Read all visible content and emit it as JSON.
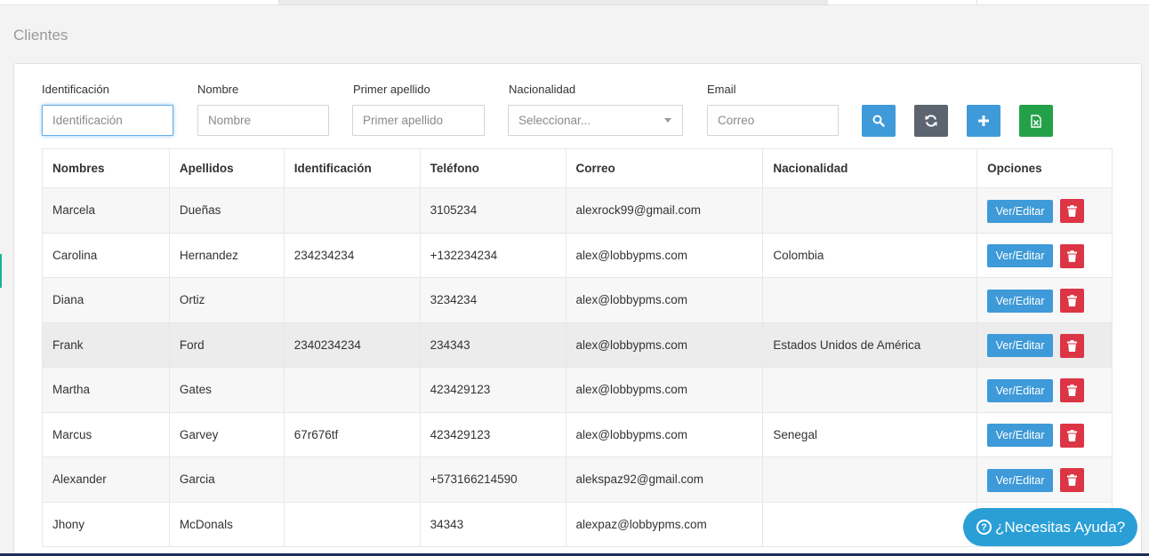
{
  "page": {
    "title": "Clientes"
  },
  "filters": {
    "identificacion": {
      "label": "Identificación",
      "placeholder": "Identificación"
    },
    "nombre": {
      "label": "Nombre",
      "placeholder": "Nombre"
    },
    "primer_apellido": {
      "label": "Primer apellido",
      "placeholder": "Primer apellido"
    },
    "nacionalidad": {
      "label": "Nacionalidad",
      "selected": "Seleccionar..."
    },
    "email": {
      "label": "Email",
      "placeholder": "Correo"
    }
  },
  "toolbar": {
    "search_icon": "search-icon",
    "refresh_icon": "refresh-icon",
    "add_icon": "plus-icon",
    "excel_icon": "excel-icon"
  },
  "table": {
    "headers": [
      "Nombres",
      "Apellidos",
      "Identificación",
      "Teléfono",
      "Correo",
      "Nacionalidad",
      "Opciones"
    ],
    "rows": [
      [
        "Marcela",
        "Dueñas",
        "",
        "3105234",
        "alexrock99@gmail.com",
        ""
      ],
      [
        "Carolina",
        "Hernandez",
        "234234234",
        "+132234234",
        "alex@lobbypms.com",
        "Colombia"
      ],
      [
        "Diana",
        "Ortiz",
        "",
        "3234234",
        "alex@lobbypms.com",
        ""
      ],
      [
        "Frank",
        "Ford",
        "2340234234",
        "234343",
        "alex@lobbypms.com",
        "Estados Unidos de América"
      ],
      [
        "Martha",
        "Gates",
        "",
        "423429123",
        "alex@lobbypms.com",
        ""
      ],
      [
        "Marcus",
        "Garvey",
        "67r676tf",
        "423429123",
        "alex@lobbypms.com",
        "Senegal"
      ],
      [
        "Alexander",
        "Garcia",
        "",
        "+573166214590",
        "alekspaz92@gmail.com",
        ""
      ],
      [
        "Jhony",
        "McDonals",
        "",
        "34343",
        "alexpaz@lobbypms.com",
        ""
      ]
    ],
    "edit_label": "Ver/Editar"
  },
  "help": {
    "label": "¿Necesitas Ayuda?"
  },
  "colors": {
    "primary": "#3e9ad8",
    "danger": "#dc3545",
    "excel": "#24a148",
    "refresh": "#5c6470",
    "help": "#2a9fd6"
  }
}
